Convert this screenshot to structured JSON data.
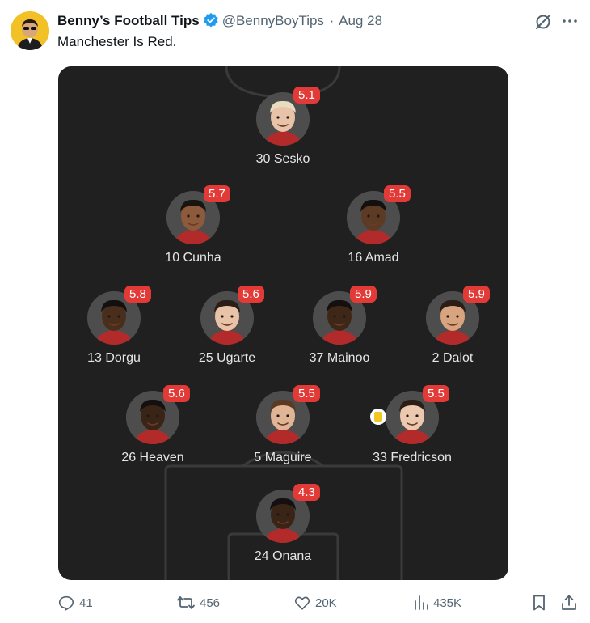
{
  "tweet": {
    "display_name": "Benny’s Football Tips",
    "handle": "@BennyBoyTips",
    "separator": "·",
    "date": "Aug 28",
    "text": "Manchester Is Red.",
    "verified_icon": "verified-badge-icon",
    "grok_icon": "grok-icon",
    "more_icon": "more-icon"
  },
  "lineup": {
    "rating_color": "#e23a36",
    "players": [
      {
        "label": "30 Sesko",
        "rating": "5.1",
        "card": false
      },
      {
        "label": "10 Cunha",
        "rating": "5.7",
        "card": false
      },
      {
        "label": "16 Amad",
        "rating": "5.5",
        "card": false
      },
      {
        "label": "13 Dorgu",
        "rating": "5.8",
        "card": false
      },
      {
        "label": "25 Ugarte",
        "rating": "5.6",
        "card": false
      },
      {
        "label": "37 Mainoo",
        "rating": "5.9",
        "card": false
      },
      {
        "label": "2 Dalot",
        "rating": "5.9",
        "card": false
      },
      {
        "label": "26 Heaven",
        "rating": "5.6",
        "card": false
      },
      {
        "label": "5 Maguire",
        "rating": "5.5",
        "card": false
      },
      {
        "label": "33 Fredricson",
        "rating": "5.5",
        "card": true
      },
      {
        "label": "24 Onana",
        "rating": "4.3",
        "card": false
      }
    ]
  },
  "actions": {
    "replies": "41",
    "reposts": "456",
    "likes": "20K",
    "views": "435K"
  }
}
